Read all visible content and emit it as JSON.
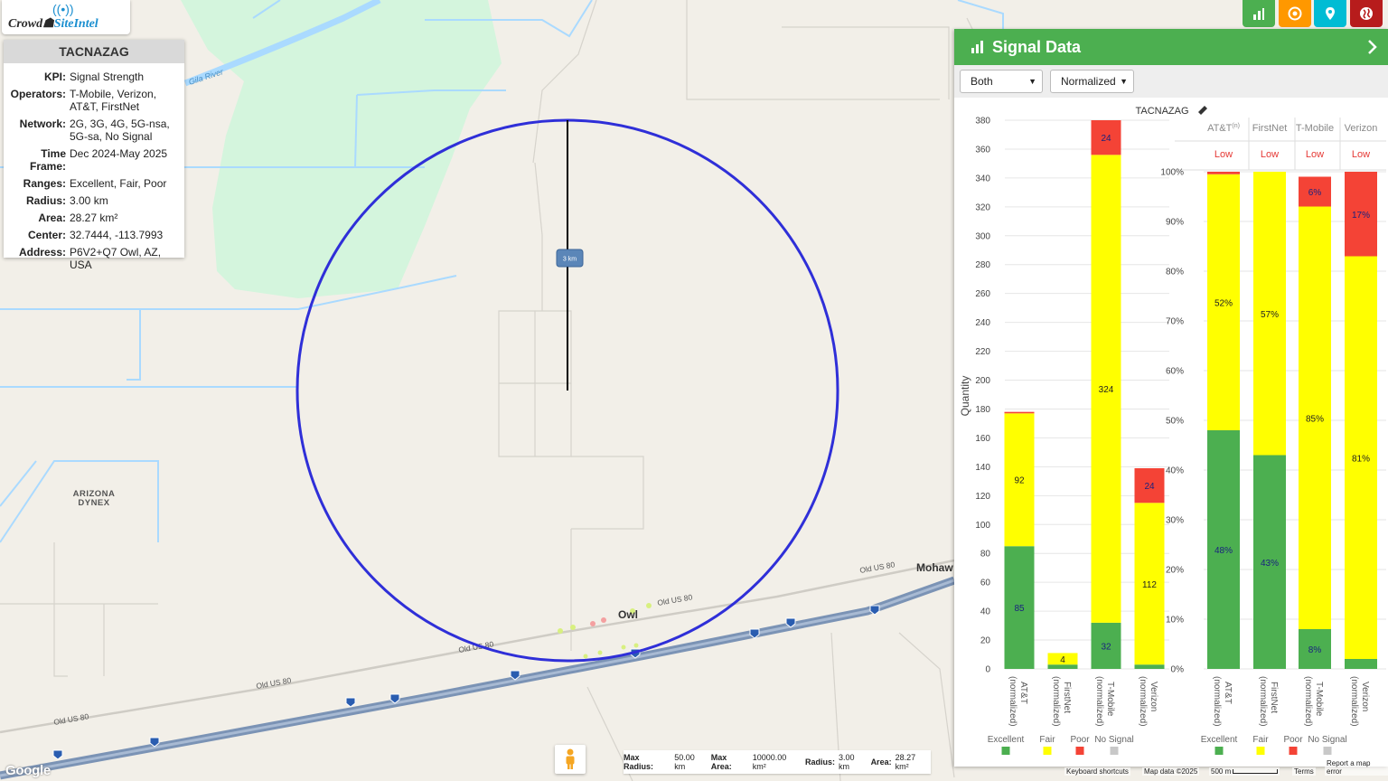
{
  "map": {
    "labels": {
      "gila_river": "Gila River",
      "arizona_dynex": "ARIZONA\nDYNEX",
      "owl": "Owl",
      "mohawk": "Mohaw",
      "old_us_80": "Old US 80"
    },
    "scale_tag": "3 km",
    "circle_color": "#2f2fd8",
    "water_color": "#aadaff",
    "park_color": "#d4f5dd",
    "highway_color": "#7b93b5"
  },
  "logo": {
    "text_a": "Crowd",
    "text_b": "SiteIntel"
  },
  "info": {
    "title": "TACNAZAG",
    "rows": [
      {
        "k": "KPI:",
        "v": "Signal Strength"
      },
      {
        "k": "Operators:",
        "v": "T-Mobile, Verizon, AT&T, FirstNet"
      },
      {
        "k": "Network:",
        "v": "2G, 3G, 4G, 5G-nsa, 5G-sa, No Signal"
      },
      {
        "k": "Time Frame:",
        "v": "Dec 2024-May 2025"
      },
      {
        "k": "Ranges:",
        "v": "Excellent, Fair, Poor"
      },
      {
        "k": "Radius:",
        "v": "3.00 km"
      },
      {
        "k": "Area:",
        "v": "28.27 km²"
      },
      {
        "k": "Center:",
        "v": "32.7444, -113.7993"
      },
      {
        "k": "Address:",
        "v": "P6V2+Q7 Owl, AZ, USA"
      }
    ]
  },
  "toolbar": [
    {
      "name": "chart-tool-button",
      "color": "#4caf50",
      "icon": "bar-chart-icon"
    },
    {
      "name": "target-tool-button",
      "color": "#ff9800",
      "icon": "target-icon"
    },
    {
      "name": "location-tool-button",
      "color": "#00bcd4",
      "icon": "pin-icon"
    },
    {
      "name": "globe-tool-button",
      "color": "#b71c1c",
      "icon": "globe-icon"
    }
  ],
  "panel": {
    "title": "Signal Data",
    "select_mode": "Both",
    "select_scale": "Normalized"
  },
  "chart_data": [
    {
      "type": "bar",
      "stacked": true,
      "title": "TACNAZAG",
      "ylabel": "Quantity",
      "ylim": [
        0,
        380
      ],
      "yticks": [
        0,
        20,
        40,
        60,
        80,
        100,
        120,
        140,
        160,
        180,
        200,
        220,
        240,
        260,
        280,
        300,
        320,
        340,
        360,
        380
      ],
      "categories": [
        "AT&T\n(normalized)",
        "FirstNet\n(normalized)",
        "T-Mobile\n(normalized)",
        "Verizon\n(normalized)"
      ],
      "series": [
        {
          "name": "Excellent",
          "color": "#4caf50",
          "values": [
            85,
            3,
            32,
            3
          ]
        },
        {
          "name": "Fair",
          "color": "#ffff00",
          "values": [
            92,
            8,
            324,
            112
          ]
        },
        {
          "name": "Poor",
          "color": "#f44336",
          "values": [
            1,
            0,
            24,
            24
          ]
        },
        {
          "name": "No Signal",
          "color": "#c8c8c8",
          "values": [
            0,
            0,
            0,
            0
          ]
        }
      ],
      "data_labels": [
        [
          85,
          null,
          32,
          null
        ],
        [
          92,
          4,
          324,
          112
        ],
        [
          null,
          null,
          24,
          24
        ]
      ]
    },
    {
      "type": "bar",
      "stacked": true,
      "percent": true,
      "ylim": [
        0,
        100
      ],
      "yticks": [
        "0%",
        "10%",
        "20%",
        "30%",
        "40%",
        "50%",
        "60%",
        "70%",
        "80%",
        "90%",
        "100%"
      ],
      "columns": [
        "AT&T",
        "FirstNet",
        "T-Mobile",
        "Verizon"
      ],
      "column_sup": [
        "(n)",
        "",
        "",
        ""
      ],
      "ratings": [
        "Low",
        "Low",
        "Low",
        "Low"
      ],
      "categories": [
        "AT&T\n(normalized)",
        "FirstNet\n(normalized)",
        "T-Mobile\n(normalized)",
        "Verizon\n(normalized)"
      ],
      "series": [
        {
          "name": "Excellent",
          "color": "#4caf50",
          "values": [
            48,
            43,
            8,
            2
          ]
        },
        {
          "name": "Fair",
          "color": "#ffff00",
          "values": [
            51.5,
            57,
            85,
            81
          ]
        },
        {
          "name": "Poor",
          "color": "#f44336",
          "values": [
            0.5,
            0,
            6,
            17
          ]
        },
        {
          "name": "No Signal",
          "color": "#c8c8c8",
          "values": [
            0,
            0,
            0,
            0
          ]
        }
      ],
      "data_labels": [
        [
          "48%",
          "43%",
          "8%",
          null
        ],
        [
          "52%",
          "57%",
          "85%",
          "81%"
        ],
        [
          null,
          null,
          "6%",
          "17%"
        ]
      ]
    }
  ],
  "footer": {
    "max_radius_label": "Max Radius:",
    "max_radius": "50.00 km",
    "max_area_label": "Max Area:",
    "max_area": "10000.00 km²",
    "radius_label": "Radius:",
    "radius": "3.00 km",
    "area_label": "Area:",
    "area": "28.27 km²",
    "google": "Google",
    "keyboard": "Keyboard shortcuts",
    "map_data": "Map data ©2025",
    "scale": "500 m",
    "terms": "Terms",
    "report": "Report a map error"
  }
}
